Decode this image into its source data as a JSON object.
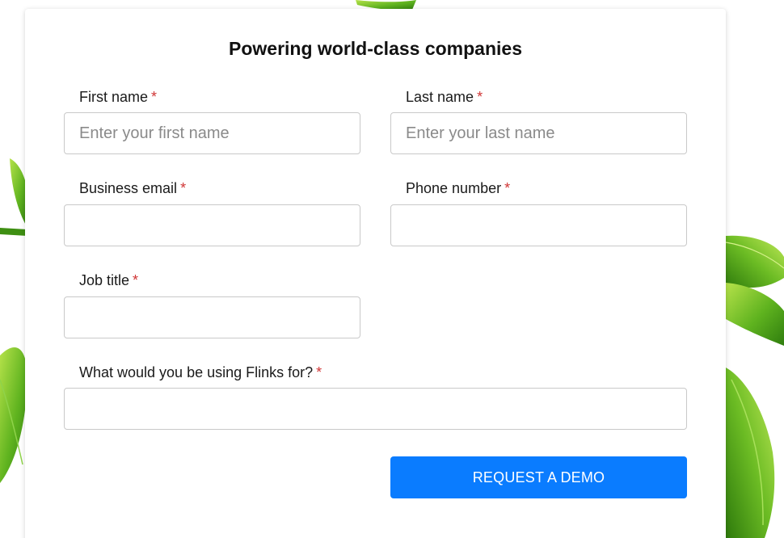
{
  "form": {
    "title": "Powering world-class companies",
    "required_marker": "*",
    "fields": {
      "first_name": {
        "label": "First name",
        "placeholder": "Enter your first name",
        "value": ""
      },
      "last_name": {
        "label": "Last name",
        "placeholder": "Enter your last name",
        "value": ""
      },
      "business_email": {
        "label": "Business email",
        "placeholder": "",
        "value": ""
      },
      "phone_number": {
        "label": "Phone number",
        "placeholder": "",
        "value": ""
      },
      "job_title": {
        "label": "Job title",
        "placeholder": "",
        "value": ""
      },
      "usage": {
        "label": "What would you be using Flinks for?",
        "placeholder": "",
        "value": ""
      }
    },
    "submit_label": "REQUEST A DEMO"
  },
  "colors": {
    "accent": "#0a7cff",
    "required": "#d03535",
    "leaf": "#4caf1c"
  },
  "background": {
    "decoration": "leaf-icon"
  }
}
